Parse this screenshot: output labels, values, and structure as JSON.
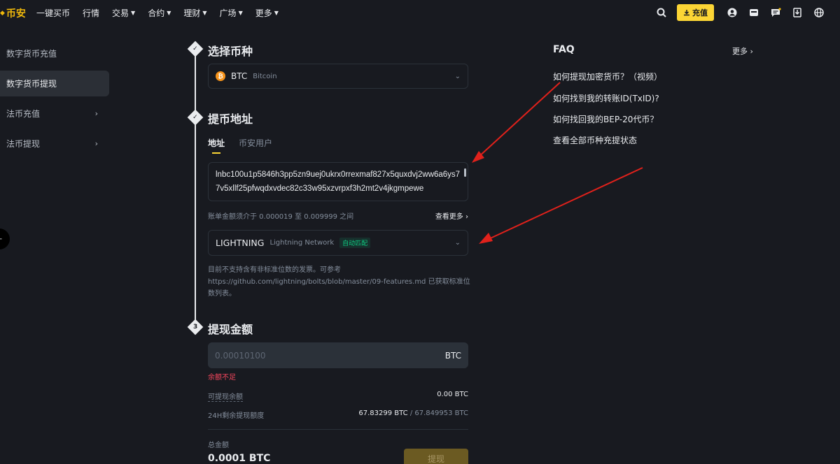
{
  "brand": {
    "name": "币安"
  },
  "nav": {
    "items": [
      {
        "label": "一键买币",
        "dropdown": false
      },
      {
        "label": "行情",
        "dropdown": false
      },
      {
        "label": "交易",
        "dropdown": true
      },
      {
        "label": "合约",
        "dropdown": true
      },
      {
        "label": "理财",
        "dropdown": true
      },
      {
        "label": "广场",
        "dropdown": true
      },
      {
        "label": "更多",
        "dropdown": true
      }
    ],
    "deposit_label": "充值"
  },
  "sidebar": {
    "items": [
      {
        "label": "数字货币充值",
        "active": false,
        "chevron": false
      },
      {
        "label": "数字货币提现",
        "active": true,
        "chevron": false
      },
      {
        "label": "法币充值",
        "active": false,
        "chevron": true
      },
      {
        "label": "法币提现",
        "active": false,
        "chevron": true
      }
    ]
  },
  "steps": {
    "coin": {
      "title": "选择币种",
      "selected_symbol": "BTC",
      "selected_name": "Bitcoin"
    },
    "address": {
      "title": "提币地址",
      "tabs": [
        "地址",
        "币安用户"
      ],
      "active_tab": 0,
      "address_value": "lnbc100u1p5846h3pp5zn9uej0ukrx0rrexmaf827x5quxdvj2ww6a6ys77v5xllf25pfwqdxvdec82c33w95xzvrpxf3h2mt2v4jkgmpewe",
      "amount_hint": "账单金额须介于 0.000019 至 0.009999 之间",
      "more_label": "查看更多",
      "network_code": "LIGHTNING",
      "network_name": "Lightning Network",
      "network_badge": "自动匹配",
      "note_line1": "目前不支持含有非标准位数的发票。可参考",
      "note_line2": "https://github.com/lightning/bolts/blob/master/09-features.md 已获取标准位数列表。"
    },
    "amount": {
      "step_number": "3",
      "title": "提现金额",
      "placeholder": "0.00010100",
      "unit": "BTC",
      "error": "余额不足",
      "available_label": "可提现余额",
      "available_value": "0.00 BTC",
      "remaining_label": "24H剩余提现额度",
      "remaining_value": "67.83299 BTC",
      "remaining_total": "/ 67.849953 BTC",
      "total_label": "总金额",
      "total_value": "0.0001 BTC",
      "withdraw_label": "提现"
    }
  },
  "faq": {
    "title": "FAQ",
    "more_label": "更多",
    "items": [
      "如何提现加密货币？（视频）",
      "如何找到我的转账ID(TxID)?",
      "如何找回我的BEP-20代币？",
      "查看全部币种充提状态"
    ]
  },
  "colors": {
    "background": "#181a20",
    "accent": "#fcd535",
    "error": "#f6465d",
    "success": "#0ecb81",
    "annotation": "#e0211b"
  }
}
